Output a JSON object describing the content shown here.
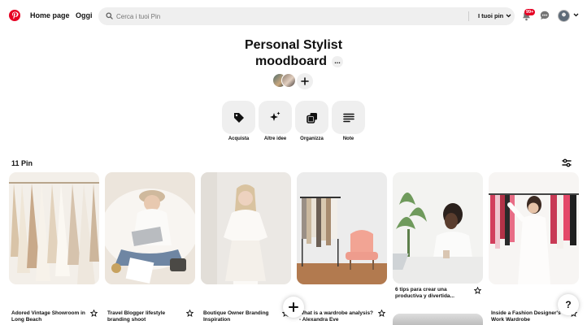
{
  "header": {
    "nav_home": "Home page",
    "nav_today": "Oggi",
    "search_placeholder": "Cerca i tuoi Pin",
    "search_scope": "I tuoi pin",
    "notification_count": "99+"
  },
  "board": {
    "title_line1": "Personal Stylist",
    "title_line2": "moodboard",
    "more_label": "...",
    "tools": [
      {
        "label": "Acquista",
        "icon": "tag-icon"
      },
      {
        "label": "Altre idee",
        "icon": "sparkle-icon"
      },
      {
        "label": "Organizza",
        "icon": "organize-icon"
      },
      {
        "label": "Note",
        "icon": "note-icon"
      }
    ],
    "pin_count": "11 Pin"
  },
  "pins": [
    {
      "title": "Adored Vintage Showroom in Long Beach",
      "palette": [
        "#efe9e0",
        "#d8c6b0",
        "#fbf8f3"
      ]
    },
    {
      "title": "Travel Blogger lifestyle branding shoot",
      "palette": [
        "#f1ebe4",
        "#cdbfa9",
        "#7c8da0"
      ]
    },
    {
      "title": "Boutique Owner Branding Inspiration",
      "palette": [
        "#e9e6e2",
        "#f6f2ec",
        "#d9c8aa"
      ]
    },
    {
      "title": "What is a wardrobe analysis? - Alexandra Eve",
      "palette": [
        "#ededec",
        "#b98765",
        "#f3a89a"
      ]
    },
    {
      "title": "6 tips para crear una productiva y divertida...",
      "palette": [
        "#f4f4f2",
        "#6b8f5a",
        "#2d2522"
      ]
    },
    {
      "title": "Inside a Fashion Designer's Work Wardrobe",
      "palette": [
        "#f5f3f0",
        "#d44561",
        "#2a2a2a"
      ]
    }
  ],
  "colors": {
    "brand": "#e60023",
    "surface": "#efefef",
    "text": "#111111"
  }
}
